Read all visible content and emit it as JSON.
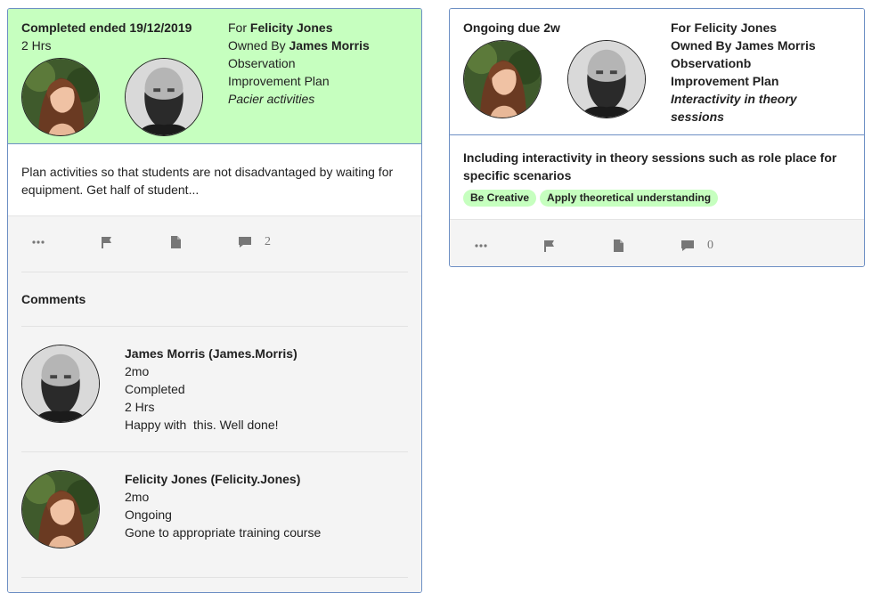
{
  "card1": {
    "status": "Completed ended 19/12/2019",
    "duration": "2 Hrs",
    "for_prefix": "For ",
    "for_name": "Felicity Jones",
    "owned_prefix": "Owned By ",
    "owned_name": "James Morris",
    "type": "Observation",
    "category": "Improvement Plan",
    "title": "Pacier activities",
    "description": "Plan activities so that students are not disadvantaged by waiting for equipment. Get half of student...",
    "comment_count": "2",
    "comments_heading": "Comments",
    "comments": [
      {
        "author": "James Morris (James.Morris)",
        "age": "2mo",
        "status": "Completed",
        "duration": "2 Hrs",
        "text": "Happy with  this. Well done!"
      },
      {
        "author": "Felicity Jones (Felicity.Jones)",
        "age": "2mo",
        "status": "Ongoing",
        "text": "Gone to appropriate training course"
      }
    ]
  },
  "card2": {
    "status": "Ongoing due 2w",
    "for_line": "For Felicity Jones",
    "owned_line": "Owned By James Morris",
    "type": "Observationb",
    "category": "Improvement Plan",
    "title": "Interactivity in theory sessions",
    "description": "Including interactivity in theory sessions such as role place for specific scenarios",
    "tags": [
      "Be Creative",
      "Apply theoretical understanding"
    ],
    "comment_count": "0"
  },
  "icons": {
    "more": "more-dots-icon",
    "flag": "flag-icon",
    "document": "document-icon",
    "comment": "comment-bubble-icon"
  },
  "colors": {
    "completed_header": "#c6ffbf",
    "tag_bg": "#c6ffbf",
    "card_border": "#6d8fc4",
    "footer_bg": "#f4f4f4"
  }
}
